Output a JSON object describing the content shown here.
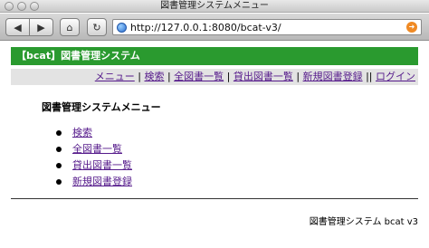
{
  "window": {
    "title": "図書管理システムメニュー",
    "url": "http://127.0.0.1:8080/bcat-v3/"
  },
  "toolbar": {
    "back_icon": "back-arrow-icon",
    "forward_icon": "forward-arrow-icon",
    "home_icon": "home-icon",
    "reload_icon": "reload-icon",
    "go_icon": "go-arrow-icon"
  },
  "page": {
    "banner": "【bcat】図書管理システム",
    "nav": {
      "items": [
        "メニュー",
        "検索",
        "全図書一覧",
        "貸出図書一覧",
        "新規図書登録",
        "ログイン"
      ],
      "separators": [
        "|",
        "|",
        "|",
        "|",
        "||"
      ]
    },
    "heading": "図書管理システムメニュー",
    "menu": [
      "検索",
      "全図書一覧",
      "貸出図書一覧",
      "新規図書登録"
    ],
    "footer": "図書管理システム bcat v3"
  },
  "colors": {
    "banner_bg": "#2a9a2f",
    "nav_bg": "#e3e3e3",
    "link": "#551a8b"
  }
}
